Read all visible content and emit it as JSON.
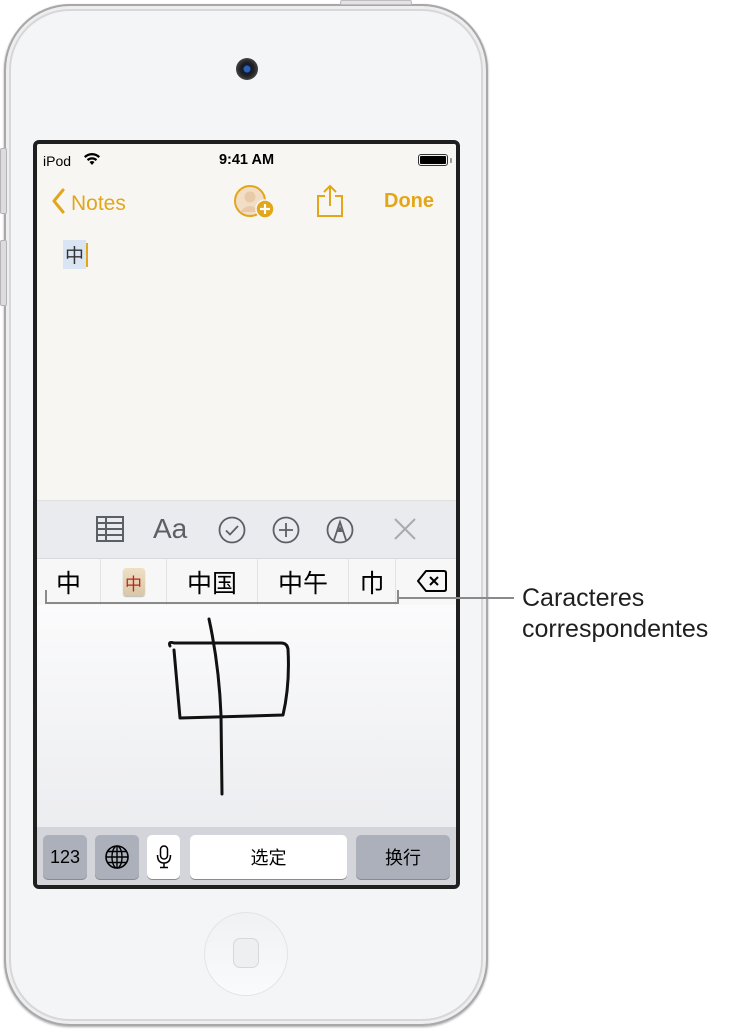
{
  "status_bar": {
    "carrier": "iPod",
    "time": "9:41 AM"
  },
  "navbar": {
    "back_label": "Notes",
    "done_label": "Done",
    "accent_color": "#e2a61b"
  },
  "note": {
    "content": "中"
  },
  "toolbar": {
    "icons": [
      "table-icon",
      "text-format-icon",
      "checklist-icon",
      "add-icon",
      "markup-icon",
      "close-icon"
    ],
    "format_label": "Aa"
  },
  "candidates": {
    "items": [
      "中",
      "中",
      "中国",
      "中午",
      "巾"
    ],
    "tile_char": "中"
  },
  "keyboard": {
    "numbers_label": "123",
    "select_label": "选定",
    "return_label": "换行"
  },
  "callout": {
    "line1": "Caracteres",
    "line2": "correspondentes"
  }
}
